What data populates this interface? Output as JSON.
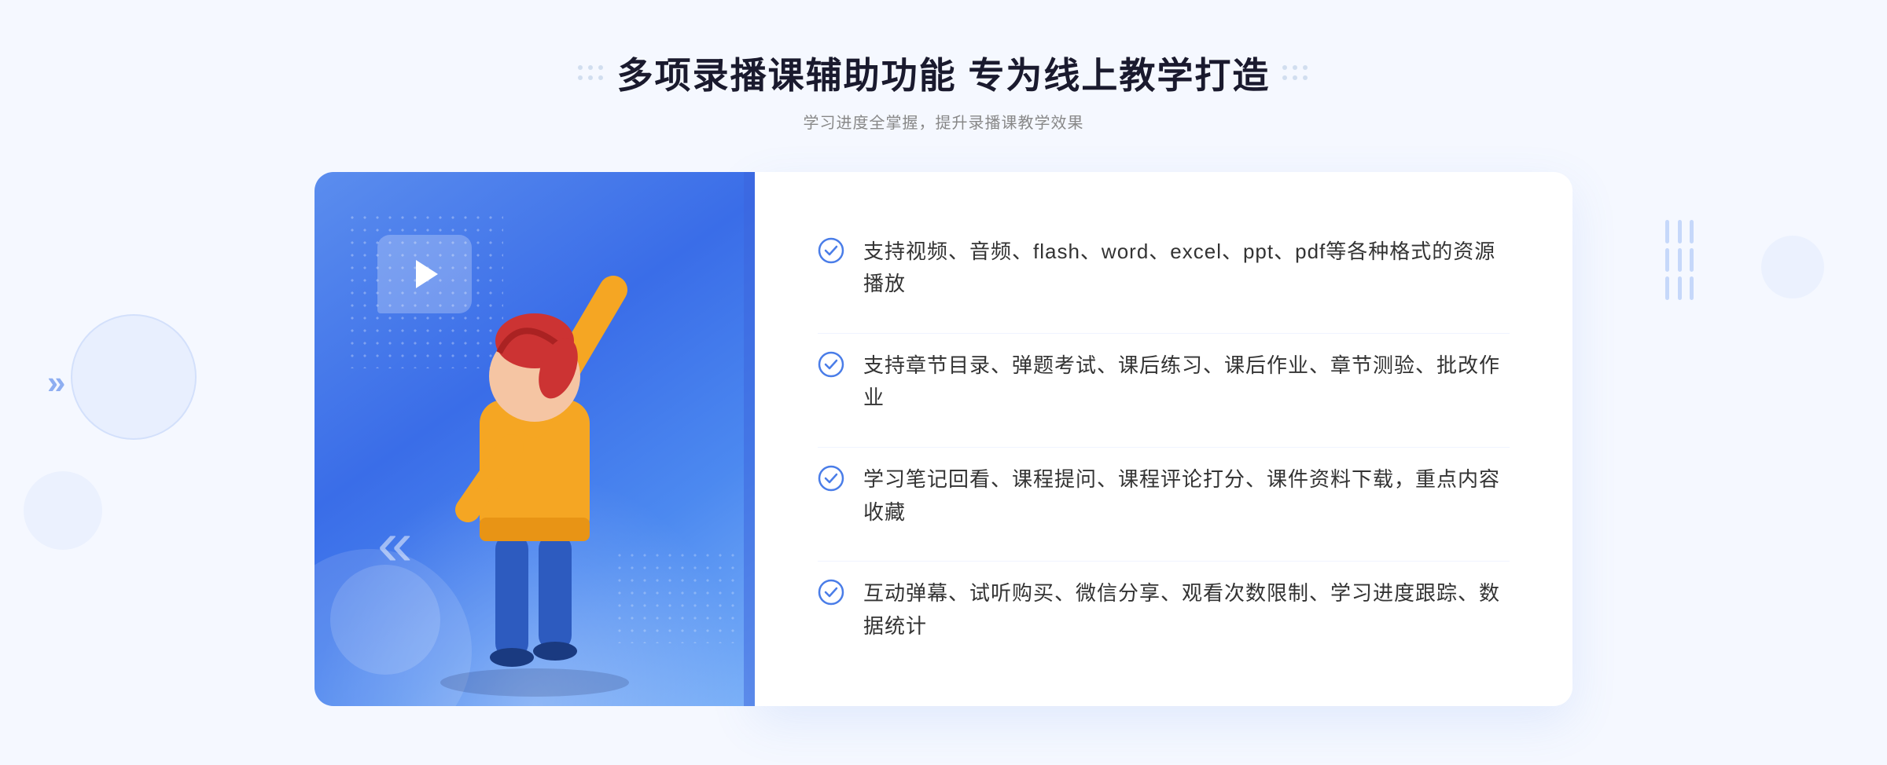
{
  "header": {
    "title": "多项录播课辅助功能 专为线上教学打造",
    "subtitle": "学习进度全掌握，提升录播课教学效果"
  },
  "features": [
    {
      "id": 1,
      "text": "支持视频、音频、flash、word、excel、ppt、pdf等各种格式的资源播放"
    },
    {
      "id": 2,
      "text": "支持章节目录、弹题考试、课后练习、课后作业、章节测验、批改作业"
    },
    {
      "id": 3,
      "text": "学习笔记回看、课程提问、课程评论打分、课件资料下载，重点内容收藏"
    },
    {
      "id": 4,
      "text": "互动弹幕、试听购买、微信分享、观看次数限制、学习进度跟踪、数据统计"
    }
  ],
  "check_icon_color": "#4a7de8",
  "decorations": {
    "chevron_left": "»",
    "dots_label": "decorative dots"
  }
}
